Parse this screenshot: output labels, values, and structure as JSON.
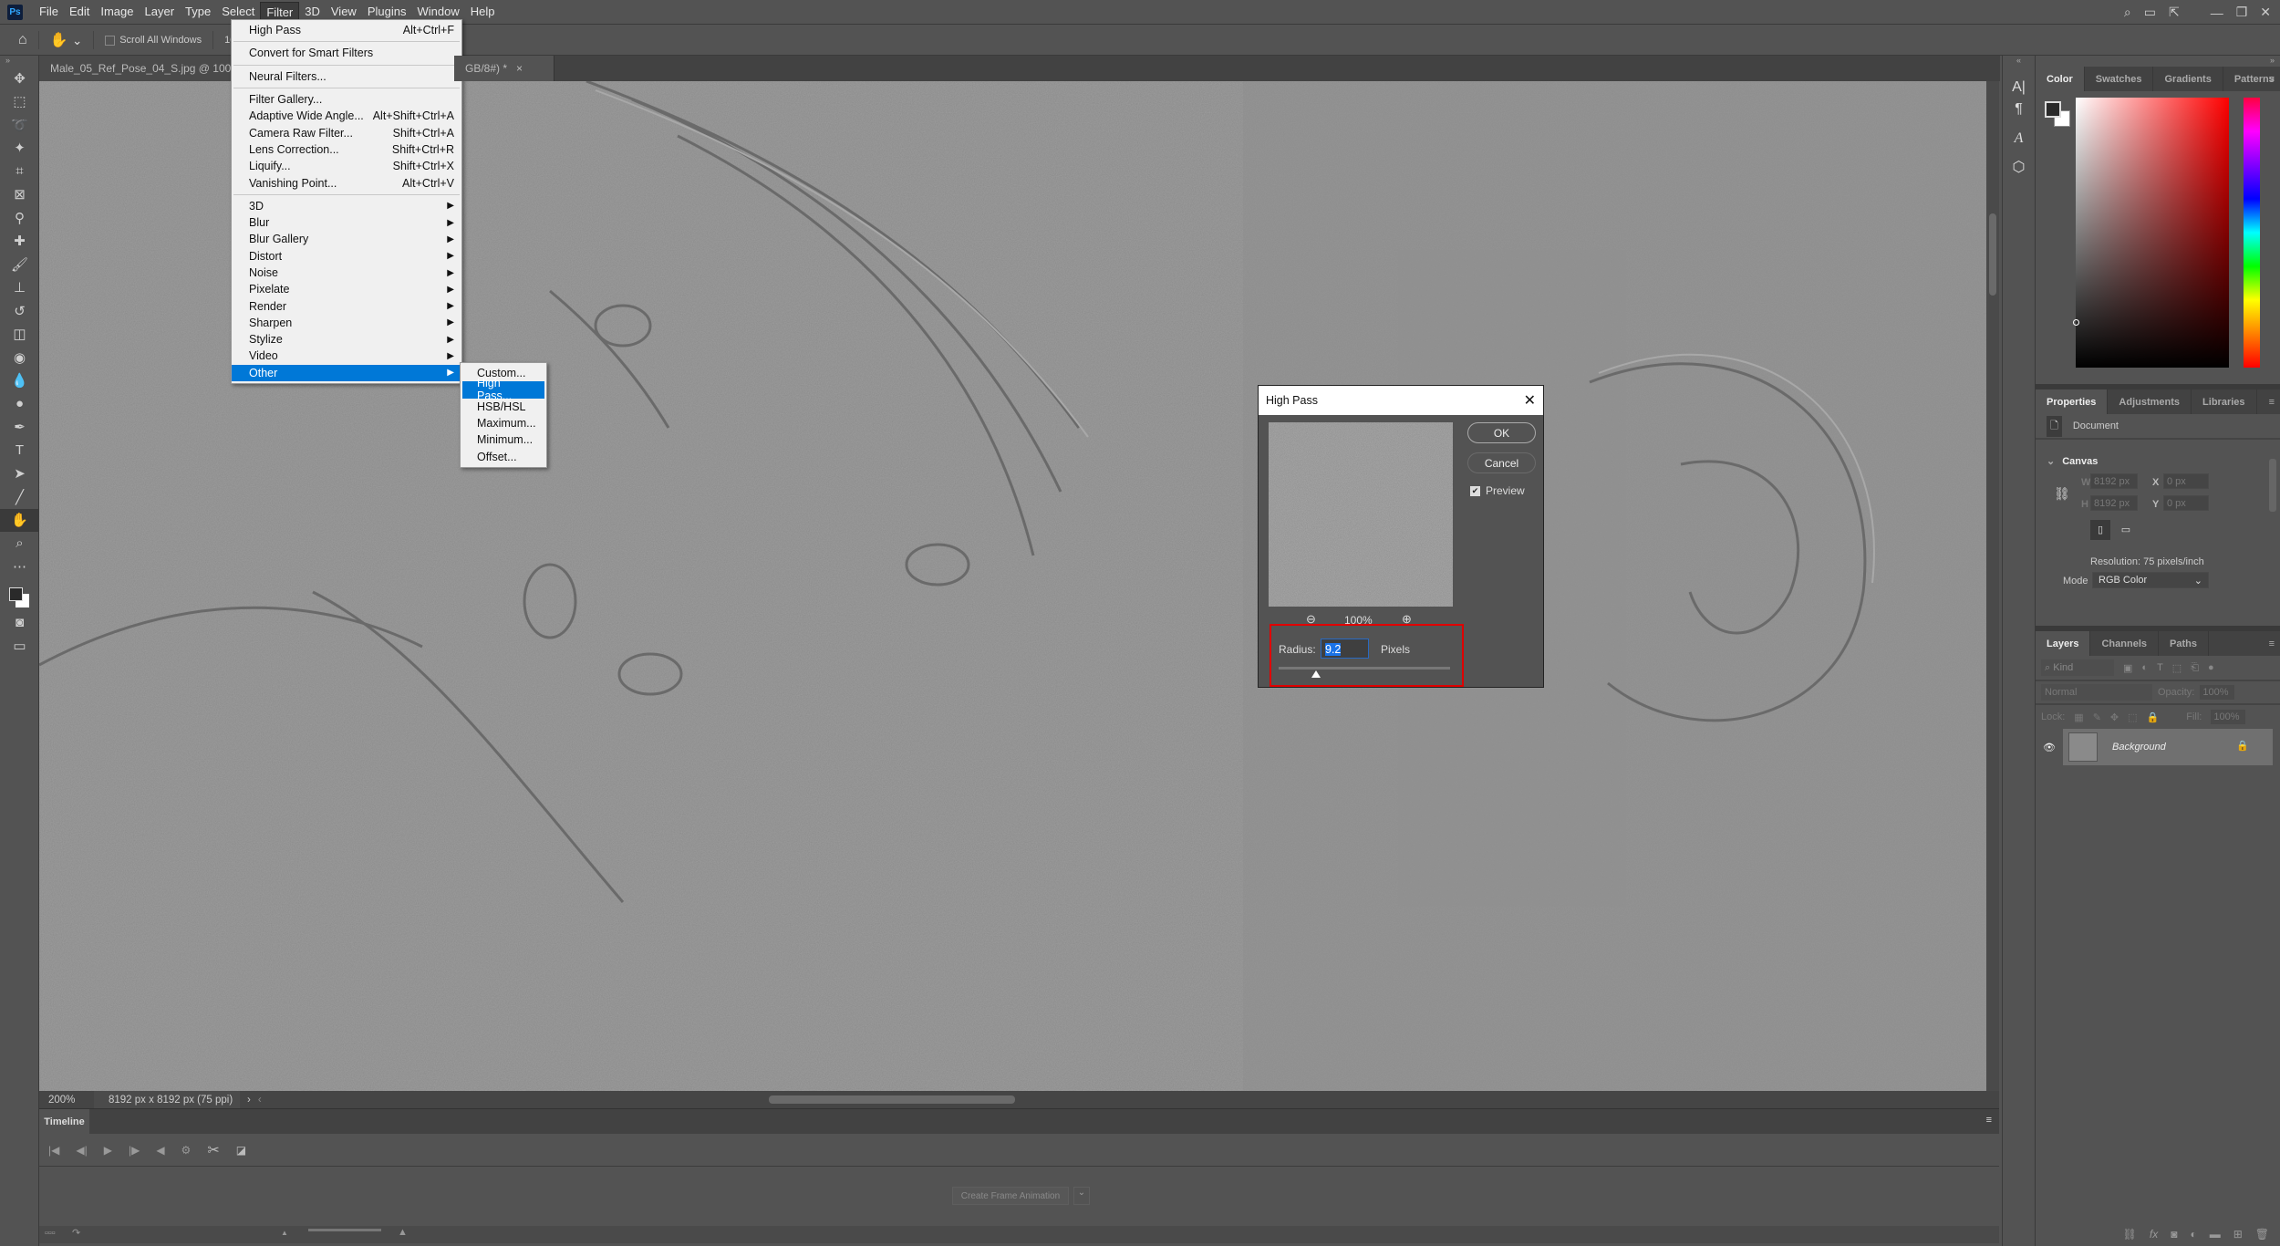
{
  "app": {
    "logo": "Ps",
    "menus": [
      "File",
      "Edit",
      "Image",
      "Layer",
      "Type",
      "Select",
      "Filter",
      "3D",
      "View",
      "Plugins",
      "Window",
      "Help"
    ],
    "active_menu": "Filter"
  },
  "options_bar": {
    "scroll_all_windows": "Scroll All Windows",
    "zoom_value": "100%"
  },
  "tabs": [
    {
      "label": "Male_05_Ref_Pose_04_S.jpg @ 100% (RGB/8#) *"
    },
    {
      "label": "GB/8#) *"
    }
  ],
  "filter_menu": {
    "items": [
      {
        "label": "High Pass",
        "shortcut": "Alt+Ctrl+F"
      },
      {
        "sep": true
      },
      {
        "label": "Convert for Smart Filters"
      },
      {
        "sep": true
      },
      {
        "label": "Neural Filters..."
      },
      {
        "sep": true
      },
      {
        "label": "Filter Gallery..."
      },
      {
        "label": "Adaptive Wide Angle...",
        "shortcut": "Alt+Shift+Ctrl+A"
      },
      {
        "label": "Camera Raw Filter...",
        "shortcut": "Shift+Ctrl+A"
      },
      {
        "label": "Lens Correction...",
        "shortcut": "Shift+Ctrl+R"
      },
      {
        "label": "Liquify...",
        "shortcut": "Shift+Ctrl+X"
      },
      {
        "label": "Vanishing Point...",
        "shortcut": "Alt+Ctrl+V"
      },
      {
        "sep": true
      },
      {
        "label": "3D",
        "sub": true
      },
      {
        "label": "Blur",
        "sub": true
      },
      {
        "label": "Blur Gallery",
        "sub": true
      },
      {
        "label": "Distort",
        "sub": true
      },
      {
        "label": "Noise",
        "sub": true
      },
      {
        "label": "Pixelate",
        "sub": true
      },
      {
        "label": "Render",
        "sub": true
      },
      {
        "label": "Sharpen",
        "sub": true
      },
      {
        "label": "Stylize",
        "sub": true
      },
      {
        "label": "Video",
        "sub": true
      },
      {
        "label": "Other",
        "sub": true,
        "highlighted": true
      }
    ]
  },
  "other_submenu": {
    "items": [
      {
        "label": "Custom..."
      },
      {
        "label": "High Pass...",
        "highlighted": true
      },
      {
        "label": "HSB/HSL"
      },
      {
        "label": "Maximum..."
      },
      {
        "label": "Minimum..."
      },
      {
        "label": "Offset..."
      }
    ]
  },
  "dialog": {
    "title": "High Pass",
    "ok": "OK",
    "cancel": "Cancel",
    "preview_label": "Preview",
    "preview_checked": true,
    "zoom": "100%",
    "radius_label": "Radius:",
    "radius_value": "9.2",
    "unit": "Pixels",
    "slider_fraction": 0.22,
    "highlight_color": "#e00000"
  },
  "status": {
    "zoom": "200%",
    "doc_info": "8192 px x 8192 px (75 ppi)"
  },
  "timeline": {
    "tab": "Timeline",
    "create_button": "Create Frame Animation"
  },
  "color_panel": {
    "tabs": [
      "Color",
      "Swatches",
      "Gradients",
      "Patterns"
    ],
    "active": "Color",
    "hue_color": "#ff0000"
  },
  "properties": {
    "tabs": [
      "Properties",
      "Adjustments",
      "Libraries"
    ],
    "active": "Properties",
    "type": "Document",
    "section": "Canvas",
    "w_label": "W",
    "w": "8192 px",
    "h_label": "H",
    "h": "8192 px",
    "x_label": "X",
    "x": "0 px",
    "y_label": "Y",
    "y": "0 px",
    "resolution": "Resolution: 75 pixels/inch",
    "mode_label": "Mode",
    "mode": "RGB Color"
  },
  "layers": {
    "tabs": [
      "Layers",
      "Channels",
      "Paths"
    ],
    "active": "Layers",
    "kind": "Kind",
    "blend": "Normal",
    "opacity_label": "Opacity:",
    "opacity": "100%",
    "lock_label": "Lock:",
    "fill_label": "Fill:",
    "fill": "100%",
    "items": [
      {
        "name": "Background",
        "visible": true,
        "locked": true
      }
    ]
  }
}
